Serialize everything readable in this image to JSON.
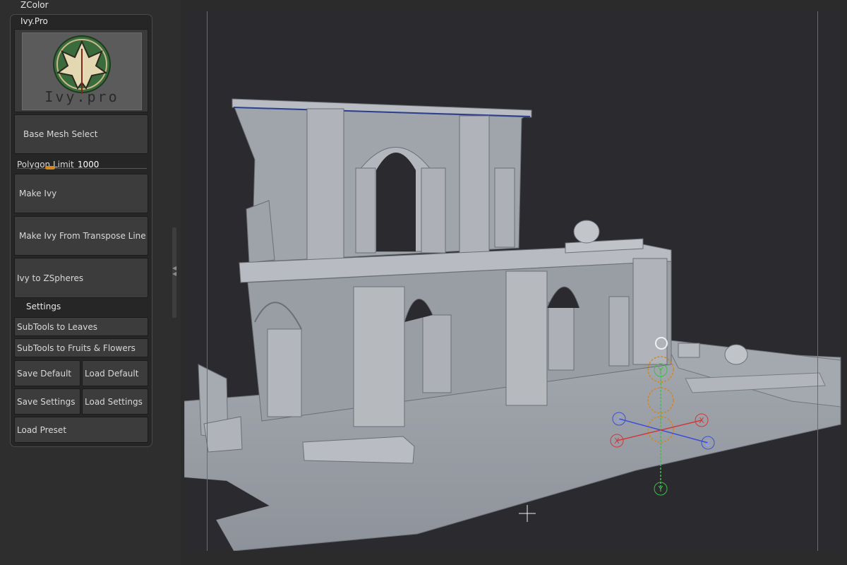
{
  "tray": {
    "menu_title": "ZColor",
    "panel_title": "Ivy.Pro",
    "logo_text": "Ivy.pro",
    "base_mesh_select": "Base Mesh Select",
    "slider": {
      "label": "Polygon Limit",
      "value": "1000",
      "fill_fraction": 0.25
    },
    "make_ivy": "Make Ivy",
    "make_ivy_transpose": "Make Ivy From Transpose Line",
    "ivy_to_zspheres": "Ivy to ZSpheres",
    "settings_label": "Settings",
    "subtools_leaves": "SubTools to Leaves",
    "subtools_fruits": "SubTools to Fruits & Flowers",
    "save_default": "Save Default",
    "load_default": "Load Default",
    "save_settings": "Save Settings",
    "load_settings": "Load Settings",
    "load_preset": "Load Preset"
  },
  "gizmo": {
    "axis_y_top": "Y",
    "axis_y_bottom": "Y",
    "axis_x_right": "X",
    "axis_x_left": "X",
    "axis_z_left": "Z",
    "axis_z_right": "Z"
  },
  "colors": {
    "accent_orange": "#d4871e",
    "axis_x": "#d0393a",
    "axis_y": "#3fbf4a",
    "axis_z": "#3a4fd6",
    "mesh": "#a9adb4"
  }
}
